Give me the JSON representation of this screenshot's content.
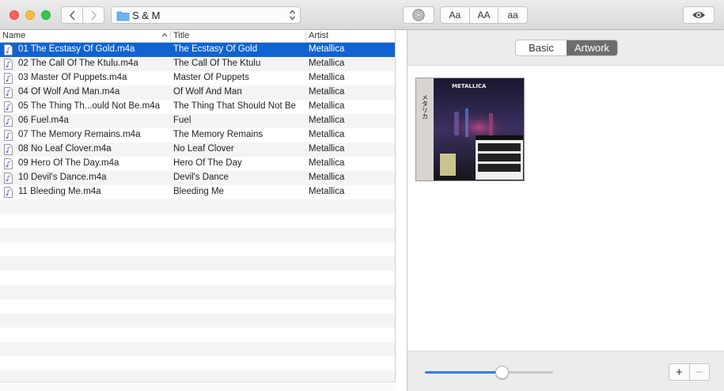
{
  "toolbar": {
    "path_label": "S & M",
    "case_buttons": [
      "Aa",
      "AA",
      "aa"
    ]
  },
  "table": {
    "columns": {
      "name": "Name",
      "title": "Title",
      "artist": "Artist"
    },
    "rows": [
      {
        "name": "01 The Ecstasy Of Gold.m4a",
        "title": "The Ecstasy Of Gold",
        "artist": "Metallica",
        "selected": true
      },
      {
        "name": "02 The Call Of The Ktulu.m4a",
        "title": "The Call Of The Ktulu",
        "artist": "Metallica"
      },
      {
        "name": "03 Master Of Puppets.m4a",
        "title": "Master Of Puppets",
        "artist": "Metallica"
      },
      {
        "name": "04 Of Wolf And Man.m4a",
        "title": "Of Wolf And Man",
        "artist": "Metallica"
      },
      {
        "name": "05 The Thing Th...ould Not Be.m4a",
        "title": "The Thing That Should Not Be",
        "artist": "Metallica"
      },
      {
        "name": "06 Fuel.m4a",
        "title": "Fuel",
        "artist": "Metallica"
      },
      {
        "name": "07 The Memory Remains.m4a",
        "title": "The Memory Remains",
        "artist": "Metallica"
      },
      {
        "name": "08 No Leaf Clover.m4a",
        "title": "No Leaf Clover",
        "artist": "Metallica"
      },
      {
        "name": "09 Hero Of The Day.m4a",
        "title": "Hero Of The Day",
        "artist": "Metallica"
      },
      {
        "name": "10 Devil's Dance.m4a",
        "title": "Devil's Dance",
        "artist": "Metallica"
      },
      {
        "name": "11 Bleeding Me.m4a",
        "title": "Bleeding Me",
        "artist": "Metallica"
      }
    ]
  },
  "inspector": {
    "tabs": {
      "basic": "Basic",
      "artwork": "Artwork"
    },
    "active_tab": "Artwork",
    "artwork_text": {
      "band": "METALLICA",
      "japanese": "メタリカ"
    },
    "zoom_fraction": 0.6,
    "add_label": "+",
    "remove_label": "−"
  },
  "colors": {
    "selection": "#0f64d2",
    "accent": "#2e7cf6"
  }
}
